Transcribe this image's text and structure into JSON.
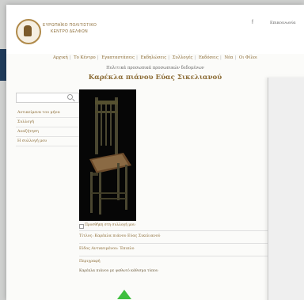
{
  "header": {
    "org_line1": "ΕΥΡΩΠΑΪΚΟ ΠΟΛΙΤΙΣΤΙΚΟ",
    "org_line2": "ΚΕΝΤΡΟ ΔΕΛΦΩΝ",
    "facebook_icon": "f",
    "contact_label": "Επικοινωνία"
  },
  "nav": {
    "items": [
      "Αρχική",
      "Το Κέντρο",
      "Εγκαταστάσεις",
      "Εκδηλώσεις",
      "Συλλογές",
      "Εκδόσεις",
      "Νέα",
      "Οι Φίλοι"
    ]
  },
  "page": {
    "subtitle": "Πολιτικά προσωπικά προσωπικών δεδομένων",
    "title": "Καρέκλα πιάνου Εύας Σικελιανού"
  },
  "sidebar": {
    "search_placeholder": "",
    "items": [
      "Αντικείμενα του μήνα",
      "Συλλογή",
      "Αναζήτηση",
      "Η συλλογή μου"
    ]
  },
  "item": {
    "add_to_collection": "Προσθήκη στη συλλογή μου",
    "title_row": "Τίτλος: Καρέκλα πιάνου Εύας Σικελιανού",
    "type_row": "Είδος Αντικειμένου: Έπιπλο",
    "description_heading": "Περιγραφή",
    "description_text": "Καρέκλα πιάνου με ψαθωτό κάθισμα τύπου"
  }
}
